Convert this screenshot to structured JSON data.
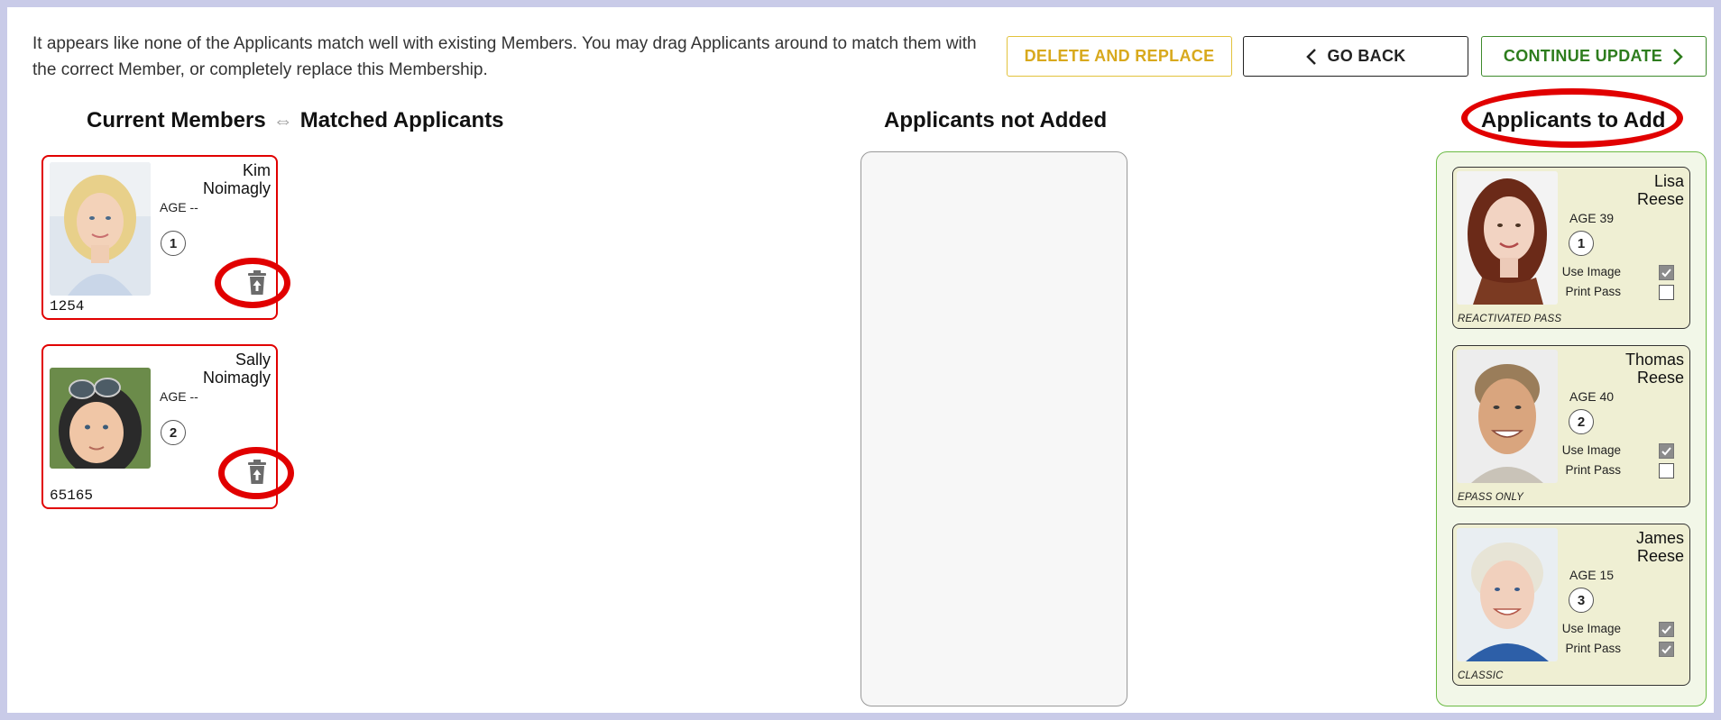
{
  "header": {
    "message": "It appears like none of the Applicants match well with existing Members. You may drag Applicants around to match them with the correct Member, or completely replace this Membership.",
    "buttons": {
      "delete_replace": "DELETE AND REPLACE",
      "go_back": "GO BACK",
      "continue_update": "CONTINUE UPDATE"
    }
  },
  "columns": {
    "current_members_title": "Current Members",
    "matched_applicants_title": "Matched Applicants",
    "not_added_title": "Applicants not Added",
    "to_add_title": "Applicants to Add"
  },
  "members": [
    {
      "first": "Kim",
      "last": "Noimagly",
      "age": "AGE --",
      "number": "1",
      "id": "1254"
    },
    {
      "first": "Sally",
      "last": "Noimagly",
      "age": "AGE --",
      "number": "2",
      "id": "65165"
    }
  ],
  "applicants": [
    {
      "first": "Lisa",
      "last": "Reese",
      "age": "AGE 39",
      "number": "1",
      "use_image_label": "Use Image",
      "print_pass_label": "Print Pass",
      "use_image": true,
      "print_pass": false,
      "pass_type": "REACTIVATED PASS"
    },
    {
      "first": "Thomas",
      "last": "Reese",
      "age": "AGE 40",
      "number": "2",
      "use_image_label": "Use Image",
      "print_pass_label": "Print Pass",
      "use_image": true,
      "print_pass": false,
      "pass_type": "EPASS ONLY"
    },
    {
      "first": "James",
      "last": "Reese",
      "age": "AGE 15",
      "number": "3",
      "use_image_label": "Use Image",
      "print_pass_label": "Print Pass",
      "use_image": true,
      "print_pass": true,
      "pass_type": "CLASSIC"
    }
  ],
  "colors": {
    "highlight_red": "#e10000",
    "delete_yellow": "#d8a91d",
    "continue_green": "#2e7d1e",
    "to_add_border": "#6aba43"
  },
  "icons": {
    "arrow": "double-arrow-icon",
    "back": "chevron-left-icon",
    "continue": "chevron-right-icon",
    "trash": "trash-restore-icon",
    "check": "checkmark-icon"
  }
}
